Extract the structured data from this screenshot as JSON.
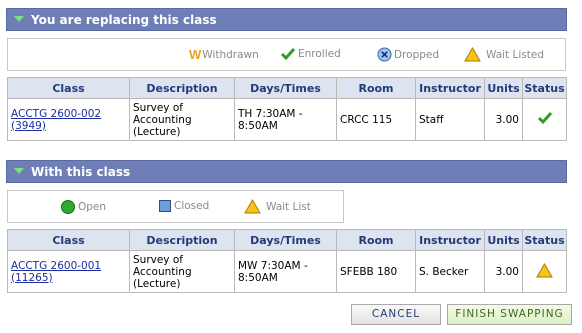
{
  "replacing": {
    "header": "You are replacing this class",
    "legend": [
      {
        "icon": "withdrawn-icon",
        "label": "Withdrawn"
      },
      {
        "icon": "enrolled-check-icon",
        "label": "Enrolled"
      },
      {
        "icon": "dropped-x-icon",
        "label": "Dropped"
      },
      {
        "icon": "wait-listed-triangle-icon",
        "label": "Wait Listed"
      }
    ],
    "columns": [
      "Class",
      "Description",
      "Days/Times",
      "Room",
      "Instructor",
      "Units",
      "Status"
    ],
    "row": {
      "class_line1": "ACCTG 2600-002",
      "class_line2": "(3949)",
      "description": [
        "Survey of",
        "Accounting",
        "(Lecture)"
      ],
      "days_times": [
        "TH 7:30AM -",
        "8:50AM"
      ],
      "room": "CRCC 115",
      "instructor": "Staff",
      "units": "3.00",
      "status_icon": "enrolled-check-icon"
    }
  },
  "with_class": {
    "header": "With this class",
    "legend": [
      {
        "icon": "open-circle-icon",
        "label": "Open"
      },
      {
        "icon": "closed-square-icon",
        "label": "Closed"
      },
      {
        "icon": "wait-list-triangle-icon",
        "label": "Wait List"
      }
    ],
    "columns": [
      "Class",
      "Description",
      "Days/Times",
      "Room",
      "Instructor",
      "Units",
      "Status"
    ],
    "row": {
      "class_line1": "ACCTG 2600-001",
      "class_line2": "(11265)",
      "description": [
        "Survey of",
        "Accounting",
        "(Lecture)"
      ],
      "days_times": [
        "MW 7:30AM -",
        "8:50AM"
      ],
      "room": "SFEBB 180",
      "instructor": "S. Becker",
      "units": "3.00",
      "status_icon": "wait-list-triangle-icon"
    }
  },
  "buttons": {
    "cancel": "CANCEL",
    "finish": "FINISH SWAPPING"
  },
  "colors": {
    "header_bg": "#6e7fb8",
    "column_header_bg": "#dde3ef",
    "enrolled_green": "#2e9e1e",
    "wait_yellow": "#f5c518",
    "open_green": "#2ea82e",
    "closed_blue": "#6f9fd8"
  }
}
